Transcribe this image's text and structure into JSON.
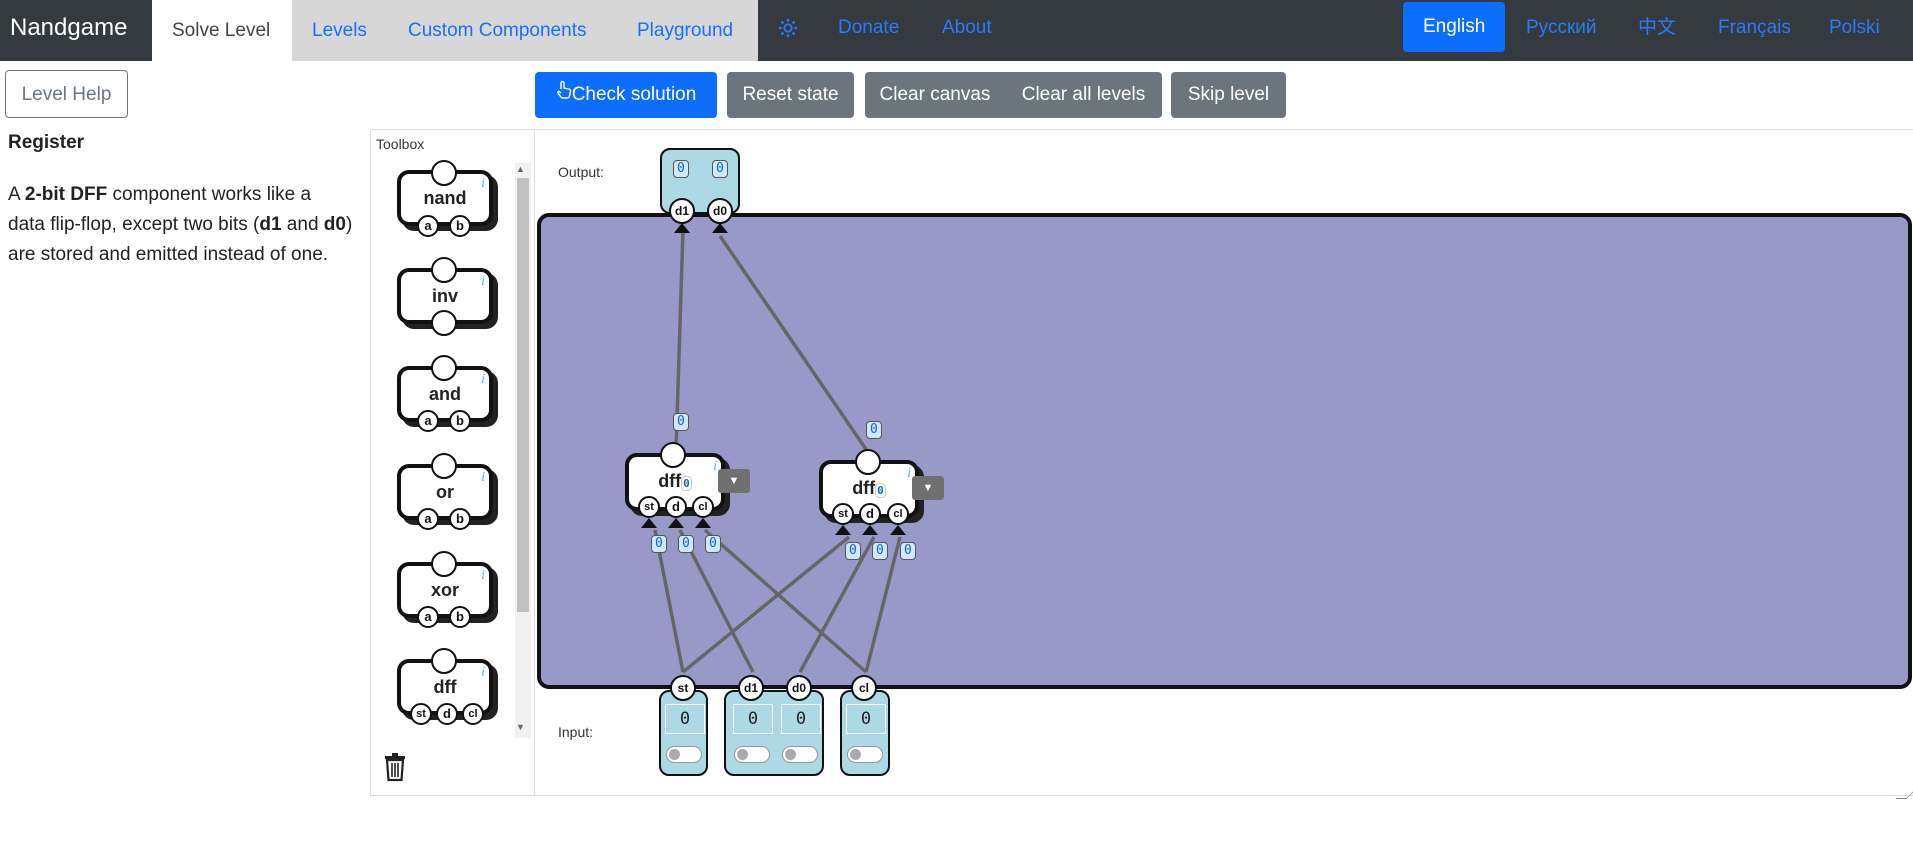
{
  "navbar": {
    "brand": "Nandgame",
    "tabs": [
      {
        "label": "Solve Level"
      },
      {
        "label": "Levels"
      },
      {
        "label": "Custom Components"
      },
      {
        "label": "Playground"
      }
    ],
    "settings_icon": "gear-icon",
    "links": [
      {
        "label": "Donate"
      },
      {
        "label": "About"
      }
    ],
    "languages": [
      {
        "label": "English"
      },
      {
        "label": "Русский"
      },
      {
        "label": "中文"
      },
      {
        "label": "Français"
      },
      {
        "label": "Polski"
      }
    ]
  },
  "toolbar": {
    "level_help": "Level Help",
    "check_solution": "Check solution",
    "check_icon": "hand-pointer-icon",
    "reset_state": "Reset state",
    "clear_canvas": "Clear canvas",
    "clear_all_levels": "Clear all levels",
    "skip_level": "Skip level"
  },
  "help": {
    "title": "Register",
    "text_pre": "A ",
    "strong1": "2-bit DFF",
    "text_mid1": " component works like a data flip-flop, except two bits (",
    "strong2": "d1",
    "text_mid2": " and ",
    "strong3": "d0",
    "text_post": ") are stored and emitted instead of one."
  },
  "toolbox": {
    "label": "Toolbox",
    "info_glyph": "i",
    "items": [
      {
        "name": "nand",
        "pins": [
          "a",
          "b"
        ]
      },
      {
        "name": "inv",
        "pins": []
      },
      {
        "name": "and",
        "pins": [
          "a",
          "b"
        ]
      },
      {
        "name": "or",
        "pins": [
          "a",
          "b"
        ]
      },
      {
        "name": "xor",
        "pins": [
          "a",
          "b"
        ]
      },
      {
        "name": "dff",
        "pins": [
          "st",
          "d",
          "cl"
        ]
      }
    ],
    "trash_icon": "trash-icon"
  },
  "canvas": {
    "output_label": "Output:",
    "input_label": "Input:",
    "output_pins": [
      {
        "name": "d1",
        "value": "0"
      },
      {
        "name": "d0",
        "value": "0"
      }
    ],
    "input_pins": [
      {
        "name": "st",
        "value": "0"
      },
      {
        "name": "d1",
        "value": "0"
      },
      {
        "name": "d0",
        "value": "0"
      },
      {
        "name": "cl",
        "value": "0"
      }
    ],
    "dff_components": [
      {
        "label": "dff",
        "state": "0",
        "out_value": "0",
        "in_values": [
          "0",
          "0",
          "0"
        ],
        "pins": [
          "st",
          "d",
          "cl"
        ]
      },
      {
        "label": "dff",
        "state": "0",
        "out_value": "0",
        "in_values": [
          "0",
          "0",
          "0"
        ],
        "pins": [
          "st",
          "d",
          "cl"
        ]
      }
    ]
  }
}
